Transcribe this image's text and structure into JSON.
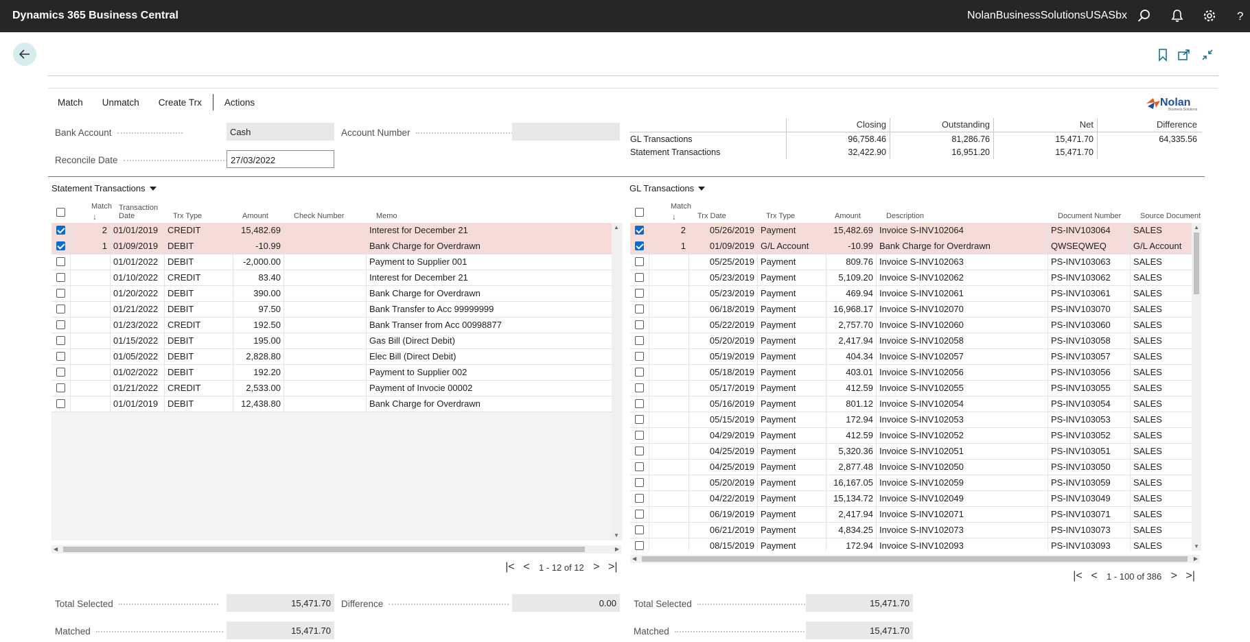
{
  "app": {
    "title": "Dynamics 365 Business Central",
    "company": "NolanBusinessSolutionsUSASbx"
  },
  "actions": [
    "Match",
    "Unmatch",
    "Create Trx",
    "Actions"
  ],
  "logo": {
    "name": "Nolan",
    "tagline": "Business Solutions"
  },
  "fields": {
    "bank_account_label": "Bank Account",
    "bank_account": "Cash",
    "account_number_label": "Account Number",
    "account_number": "",
    "reconcile_date_label": "Reconcile Date",
    "reconcile_date": "27/03/2022"
  },
  "summary": {
    "headers": [
      "Closing",
      "Outstanding",
      "Net",
      "Difference"
    ],
    "rows": [
      {
        "label": "GL Transactions",
        "values": [
          "96,758.46",
          "81,286.76",
          "15,471.70",
          "64,335.56"
        ]
      },
      {
        "label": "Statement Transactions",
        "values": [
          "32,422.90",
          "16,951.20",
          "15,471.70",
          ""
        ]
      }
    ]
  },
  "statement": {
    "title": "Statement Transactions",
    "headers": {
      "match": "Match",
      "arrow": "↓",
      "date1": "Transaction",
      "date2": "Date",
      "type": "Trx Type",
      "amount": "Amount",
      "check": "Check Number",
      "memo": "Memo"
    },
    "rows": [
      {
        "checked": true,
        "match": "2",
        "date": "01/01/2019",
        "type": "CREDIT",
        "amount": "15,482.69",
        "check": "",
        "memo": "Interest for December 21"
      },
      {
        "checked": true,
        "match": "1",
        "date": "01/09/2019",
        "type": "DEBIT",
        "amount": "-10.99",
        "check": "",
        "memo": "Bank Charge for Overdrawn"
      },
      {
        "checked": false,
        "match": "",
        "date": "01/01/2022",
        "type": "DEBIT",
        "amount": "-2,000.00",
        "check": "",
        "memo": "Payment to Supplier 001"
      },
      {
        "checked": false,
        "match": "",
        "date": "01/10/2022",
        "type": "CREDIT",
        "amount": "83.40",
        "check": "",
        "memo": "Interest for December 21"
      },
      {
        "checked": false,
        "match": "",
        "date": "01/20/2022",
        "type": "DEBIT",
        "amount": "390.00",
        "check": "",
        "memo": "Bank Charge for Overdrawn"
      },
      {
        "checked": false,
        "match": "",
        "date": "01/21/2022",
        "type": "DEBIT",
        "amount": "97.50",
        "check": "",
        "memo": "Bank Transfer to Acc 99999999"
      },
      {
        "checked": false,
        "match": "",
        "date": "01/23/2022",
        "type": "CREDIT",
        "amount": "192.50",
        "check": "",
        "memo": "Bank Transer from Acc 00998877"
      },
      {
        "checked": false,
        "match": "",
        "date": "01/15/2022",
        "type": "DEBIT",
        "amount": "195.00",
        "check": "",
        "memo": "Gas Bill (Direct Debit)"
      },
      {
        "checked": false,
        "match": "",
        "date": "01/05/2022",
        "type": "DEBIT",
        "amount": "2,828.80",
        "check": "",
        "memo": "Elec Bill (Direct Debit)"
      },
      {
        "checked": false,
        "match": "",
        "date": "01/02/2022",
        "type": "DEBIT",
        "amount": "192.20",
        "check": "",
        "memo": "Payment to Supplier 002"
      },
      {
        "checked": false,
        "match": "",
        "date": "01/21/2022",
        "type": "CREDIT",
        "amount": "2,533.00",
        "check": "",
        "memo": "Payment of Invocie 00002"
      },
      {
        "checked": false,
        "match": "",
        "date": "01/01/2019",
        "type": "DEBIT",
        "amount": "12,438.80",
        "check": "",
        "memo": "Bank Charge for Overdrawn"
      }
    ],
    "pager": "1 - 12 of 12",
    "total_selected_label": "Total Selected",
    "total_selected": "15,471.70",
    "difference_label": "Difference",
    "difference": "0.00",
    "matched_label": "Matched",
    "matched": "15,471.70"
  },
  "gl": {
    "title": "GL Transactions",
    "headers": {
      "match": "Match",
      "arrow": "↓",
      "date": "Trx Date",
      "type": "Trx Type",
      "amount": "Amount",
      "desc": "Description",
      "doc": "Document Number",
      "src": "Source Document"
    },
    "rows": [
      {
        "checked": true,
        "match": "2",
        "date": "05/26/2019",
        "type": "Payment",
        "amount": "15,482.69",
        "desc": "Invoice S-INV102064",
        "doc": "PS-INV103064",
        "src": "SALES"
      },
      {
        "checked": true,
        "match": "1",
        "date": "01/09/2019",
        "type": "G/L Account",
        "amount": "-10.99",
        "desc": "Bank Charge for Overdrawn",
        "doc": "QWSEQWEQ",
        "src": "G/L Account"
      },
      {
        "checked": false,
        "match": "",
        "date": "05/25/2019",
        "type": "Payment",
        "amount": "809.76",
        "desc": "Invoice S-INV102063",
        "doc": "PS-INV103063",
        "src": "SALES"
      },
      {
        "checked": false,
        "match": "",
        "date": "05/23/2019",
        "type": "Payment",
        "amount": "5,109.20",
        "desc": "Invoice S-INV102062",
        "doc": "PS-INV103062",
        "src": "SALES"
      },
      {
        "checked": false,
        "match": "",
        "date": "05/23/2019",
        "type": "Payment",
        "amount": "469.94",
        "desc": "Invoice S-INV102061",
        "doc": "PS-INV103061",
        "src": "SALES"
      },
      {
        "checked": false,
        "match": "",
        "date": "06/18/2019",
        "type": "Payment",
        "amount": "16,968.17",
        "desc": "Invoice S-INV102070",
        "doc": "PS-INV103070",
        "src": "SALES"
      },
      {
        "checked": false,
        "match": "",
        "date": "05/22/2019",
        "type": "Payment",
        "amount": "2,757.70",
        "desc": "Invoice S-INV102060",
        "doc": "PS-INV103060",
        "src": "SALES"
      },
      {
        "checked": false,
        "match": "",
        "date": "05/20/2019",
        "type": "Payment",
        "amount": "2,417.94",
        "desc": "Invoice S-INV102058",
        "doc": "PS-INV103058",
        "src": "SALES"
      },
      {
        "checked": false,
        "match": "",
        "date": "05/19/2019",
        "type": "Payment",
        "amount": "404.34",
        "desc": "Invoice S-INV102057",
        "doc": "PS-INV103057",
        "src": "SALES"
      },
      {
        "checked": false,
        "match": "",
        "date": "05/18/2019",
        "type": "Payment",
        "amount": "403.01",
        "desc": "Invoice S-INV102056",
        "doc": "PS-INV103056",
        "src": "SALES"
      },
      {
        "checked": false,
        "match": "",
        "date": "05/17/2019",
        "type": "Payment",
        "amount": "412.59",
        "desc": "Invoice S-INV102055",
        "doc": "PS-INV103055",
        "src": "SALES"
      },
      {
        "checked": false,
        "match": "",
        "date": "05/16/2019",
        "type": "Payment",
        "amount": "801.12",
        "desc": "Invoice S-INV102054",
        "doc": "PS-INV103054",
        "src": "SALES"
      },
      {
        "checked": false,
        "match": "",
        "date": "05/15/2019",
        "type": "Payment",
        "amount": "172.94",
        "desc": "Invoice S-INV102053",
        "doc": "PS-INV103053",
        "src": "SALES"
      },
      {
        "checked": false,
        "match": "",
        "date": "04/29/2019",
        "type": "Payment",
        "amount": "412.59",
        "desc": "Invoice S-INV102052",
        "doc": "PS-INV103052",
        "src": "SALES"
      },
      {
        "checked": false,
        "match": "",
        "date": "04/25/2019",
        "type": "Payment",
        "amount": "5,320.36",
        "desc": "Invoice S-INV102051",
        "doc": "PS-INV103051",
        "src": "SALES"
      },
      {
        "checked": false,
        "match": "",
        "date": "04/25/2019",
        "type": "Payment",
        "amount": "2,877.48",
        "desc": "Invoice S-INV102050",
        "doc": "PS-INV103050",
        "src": "SALES"
      },
      {
        "checked": false,
        "match": "",
        "date": "05/20/2019",
        "type": "Payment",
        "amount": "16,167.05",
        "desc": "Invoice S-INV102059",
        "doc": "PS-INV103059",
        "src": "SALES"
      },
      {
        "checked": false,
        "match": "",
        "date": "04/22/2019",
        "type": "Payment",
        "amount": "15,134.72",
        "desc": "Invoice S-INV102049",
        "doc": "PS-INV103049",
        "src": "SALES"
      },
      {
        "checked": false,
        "match": "",
        "date": "06/19/2019",
        "type": "Payment",
        "amount": "2,417.94",
        "desc": "Invoice S-INV102071",
        "doc": "PS-INV103071",
        "src": "SALES"
      },
      {
        "checked": false,
        "match": "",
        "date": "06/21/2019",
        "type": "Payment",
        "amount": "4,834.25",
        "desc": "Invoice S-INV102073",
        "doc": "PS-INV103073",
        "src": "SALES"
      },
      {
        "checked": false,
        "match": "",
        "date": "08/15/2019",
        "type": "Payment",
        "amount": "172.94",
        "desc": "Invoice S-INV102093",
        "doc": "PS-INV103093",
        "src": "SALES"
      }
    ],
    "pager": "1 - 100 of 386",
    "total_selected_label": "Total Selected",
    "total_selected": "15,471.70",
    "matched_label": "Matched",
    "matched": "15,471.70"
  }
}
